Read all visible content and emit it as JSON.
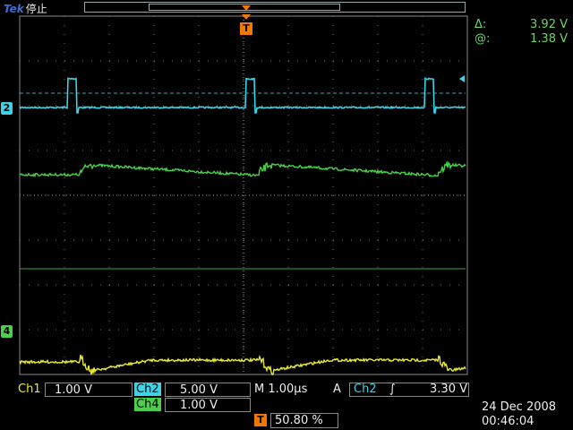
{
  "header": {
    "brand": "Tek",
    "status": "停止"
  },
  "cursors": {
    "delta_symbol": "Δ:",
    "delta_value": "3.92 V",
    "at_symbol": "@:",
    "at_value": "1.38 V"
  },
  "markers": {
    "ch2": "2",
    "ch4": "4",
    "trigger": "T"
  },
  "channels": {
    "ch1": {
      "label": "Ch1",
      "scale": "1.00 V"
    },
    "ch2": {
      "label": "Ch2",
      "scale": "5.00 V"
    },
    "ch4": {
      "label": "Ch4",
      "scale": "1.00 V"
    }
  },
  "timebase": {
    "mode": "M",
    "scale": "1.00µs"
  },
  "trigger": {
    "label": "A",
    "source": "Ch2",
    "slope": "∫",
    "level": "3.30 V",
    "position": "50.80 %"
  },
  "datetime": {
    "date": "24 Dec  2008",
    "time": "00:46:04"
  },
  "colors": {
    "ch1": "#eaea30",
    "ch2": "#3fd3e6",
    "ch4": "#4ad04a",
    "trigger": "#f07800",
    "brand": "#3b6cd9"
  },
  "waveforms": {
    "ch2": "pulse-train",
    "ch4": "ramp-with-spikes",
    "ch1": "ramp-with-spikes"
  }
}
